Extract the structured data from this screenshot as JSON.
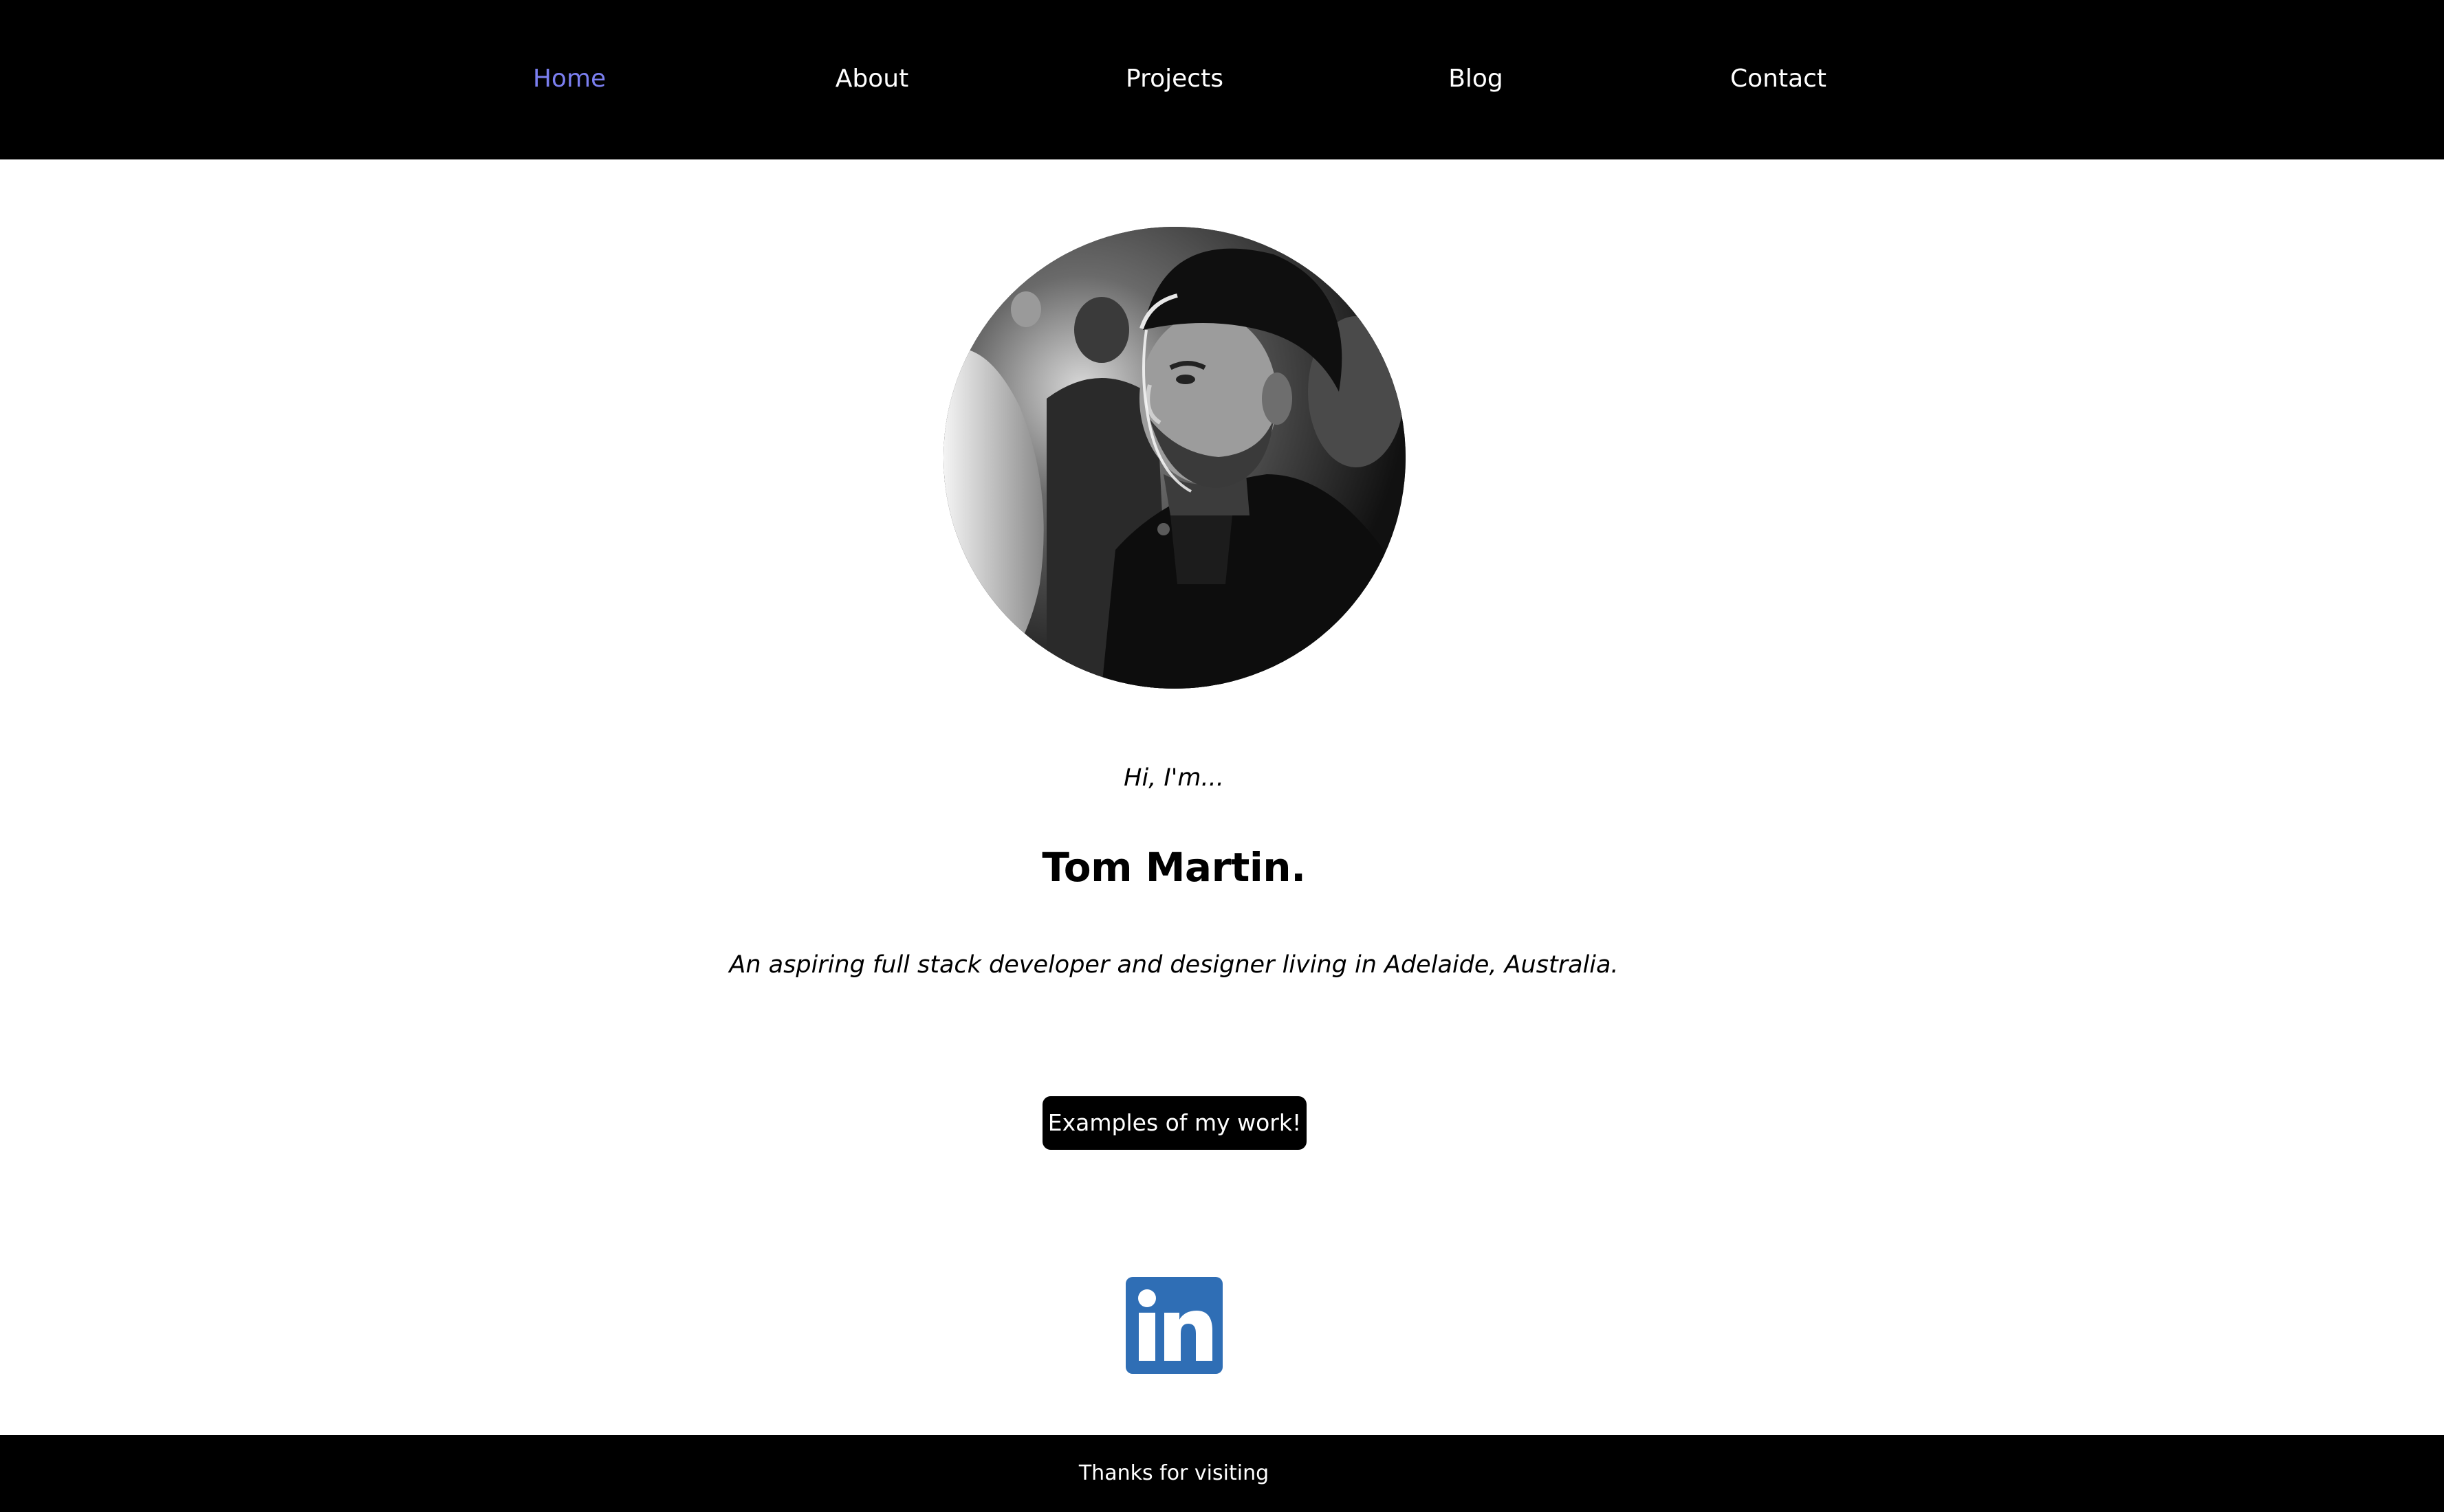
{
  "nav": {
    "items": [
      {
        "label": "Home",
        "active": true
      },
      {
        "label": "About",
        "active": false
      },
      {
        "label": "Projects",
        "active": false
      },
      {
        "label": "Blog",
        "active": false
      },
      {
        "label": "Contact",
        "active": false
      }
    ],
    "active_color": "#7b7ff0",
    "text_color": "#ffffff",
    "background": "#000000"
  },
  "hero": {
    "avatar_icon": "profile-photo",
    "greeting": "Hi, I'm...",
    "name": "Tom Martin.",
    "tagline": "An aspiring full stack developer and designer living in Adelaide, Australia.",
    "cta_label": "Examples of my work!"
  },
  "social": {
    "linkedin_icon": "linkedin-icon",
    "linkedin_color": "#2f6eb5"
  },
  "footer": {
    "text": "Thanks for visiting"
  }
}
